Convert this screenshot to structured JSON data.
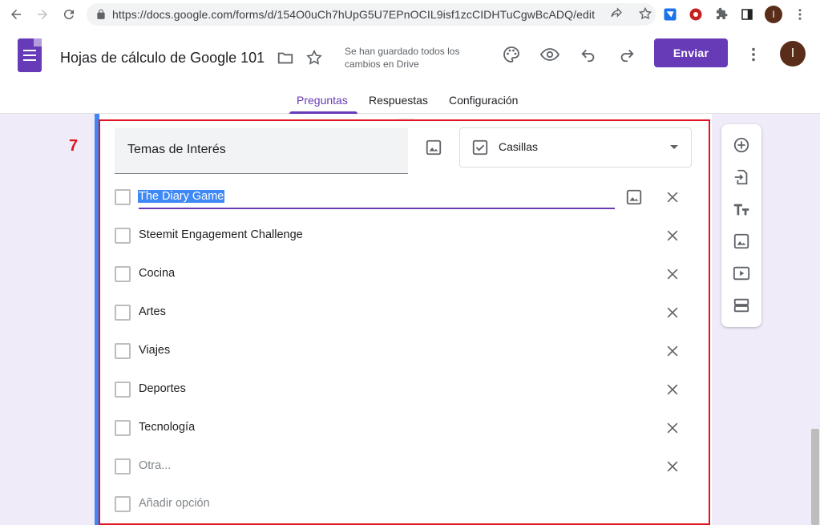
{
  "browser": {
    "url": "https://docs.google.com/forms/d/154O0uCh7hUpG5U7EPnOCIL9isf1zcCIDHTuCgwBcADQ/edit",
    "profile_initial": "I"
  },
  "header": {
    "doc_title": "Hojas de cálculo de Google 101",
    "save_status": "Se han guardado todos los cambios en Drive",
    "send_label": "Enviar",
    "account_initial": "I",
    "brand_color": "#673ab7"
  },
  "tabs": [
    {
      "label": "Preguntas",
      "active": true
    },
    {
      "label": "Respuestas",
      "active": false
    },
    {
      "label": "Configuración",
      "active": false
    }
  ],
  "annotation": {
    "step_number": "7",
    "color": "#e0141e"
  },
  "question": {
    "title": "Temas de Interés",
    "type_label": "Casillas",
    "options": [
      {
        "label": "The Diary Game",
        "selected": true
      },
      {
        "label": "Steemit Engagement Challenge"
      },
      {
        "label": "Cocina"
      },
      {
        "label": "Artes"
      },
      {
        "label": "Viajes"
      },
      {
        "label": "Deportes"
      },
      {
        "label": "Tecnología"
      }
    ],
    "other_label": "Otra...",
    "add_option_label": "Añadir opción"
  },
  "side_toolbar": {
    "icons": [
      "add-question-icon",
      "import-questions-icon",
      "add-title-icon",
      "add-image-icon",
      "add-video-icon",
      "add-section-icon"
    ]
  }
}
